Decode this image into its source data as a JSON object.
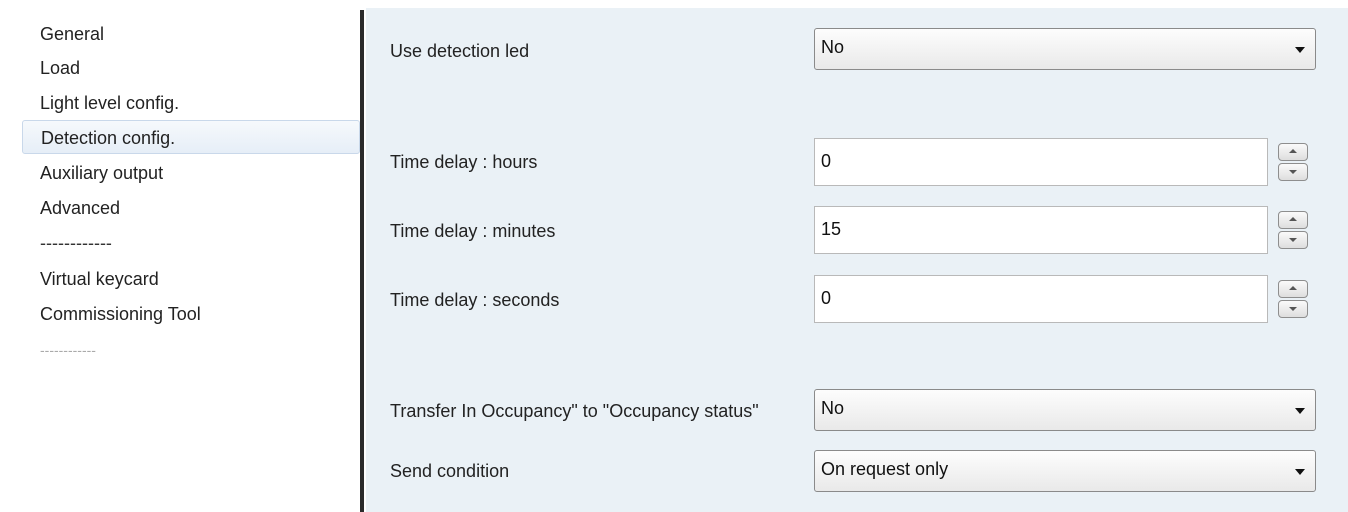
{
  "sidebar": {
    "items": [
      {
        "label": "General"
      },
      {
        "label": "Load"
      },
      {
        "label": "Light level config."
      },
      {
        "label": "Detection config.",
        "selected": true
      },
      {
        "label": "Auxiliary output"
      },
      {
        "label": "Advanced"
      },
      {
        "label": "------------"
      },
      {
        "label": "Virtual keycard"
      },
      {
        "label": "Commissioning Tool"
      },
      {
        "label": "------------"
      }
    ]
  },
  "params": {
    "use_detection_led": {
      "label": "Use detection led",
      "value": "No"
    },
    "time_delay_hours": {
      "label": "Time delay : hours",
      "value": "0"
    },
    "time_delay_minutes": {
      "label": "Time delay : minutes",
      "value": "15"
    },
    "time_delay_seconds": {
      "label": "Time delay : seconds",
      "value": "0"
    },
    "transfer_occupancy": {
      "label": "Transfer In Occupancy\" to \"Occupancy status\"",
      "value": "No"
    },
    "send_condition": {
      "label": "Send condition",
      "value": "On request only"
    }
  }
}
